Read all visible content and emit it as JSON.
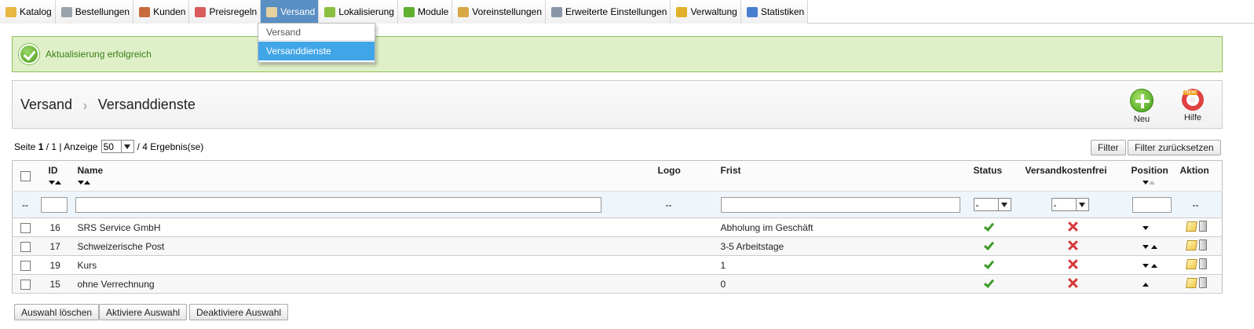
{
  "nav": {
    "items": [
      {
        "label": "Katalog",
        "icon": "folder-icon",
        "color": "#e8b642"
      },
      {
        "label": "Bestellungen",
        "icon": "cart-icon",
        "color": "#9aa3ab"
      },
      {
        "label": "Kunden",
        "icon": "user-icon",
        "color": "#c76b3c"
      },
      {
        "label": "Preisregeln",
        "icon": "price-rules-icon",
        "color": "#d95b5b"
      },
      {
        "label": "Versand",
        "icon": "truck-icon",
        "color": "#e7d1a1"
      },
      {
        "label": "Lokalisierung",
        "icon": "globe-icon",
        "color": "#8bbf3f"
      },
      {
        "label": "Module",
        "icon": "puzzle-icon",
        "color": "#5fb02f"
      },
      {
        "label": "Voreinstellungen",
        "icon": "preferences-icon",
        "color": "#d8a845"
      },
      {
        "label": "Erweiterte Einstellungen",
        "icon": "wrench-icon",
        "color": "#8a96a8"
      },
      {
        "label": "Verwaltung",
        "icon": "key-icon",
        "color": "#e2b12c"
      },
      {
        "label": "Statistiken",
        "icon": "bar-chart-icon",
        "color": "#4a7fd0"
      }
    ],
    "active": "Versand"
  },
  "dropdown": {
    "title": "Versand",
    "item": "Versanddienste"
  },
  "success": {
    "message": "Aktualisierung erfolgreich"
  },
  "toolbar": {
    "crumb1": "Versand",
    "separator": "›",
    "crumb2": "Versanddienste",
    "new_label": "Neu",
    "help_label": "Hilfe",
    "help_badge": "NEW"
  },
  "pager": {
    "seite_prefix": "Seite",
    "page": "1",
    "of": "/ 1 | Anzeige",
    "per_page": "50",
    "results": "/ 4 Ergebnis(se)"
  },
  "filter_buttons": {
    "filter": "Filter",
    "reset": "Filter zurücksetzen"
  },
  "columns": {
    "id": "ID",
    "name": "Name",
    "logo": "Logo",
    "frist": "Frist",
    "status": "Status",
    "versandkostenfrei": "Versandkostenfrei",
    "position": "Position",
    "aktion": "Aktion"
  },
  "filter_row": {
    "dash": "--",
    "logo_dash": "--",
    "aktion_dash": "--",
    "status_value": "-",
    "vkf_value": "-"
  },
  "rows": [
    {
      "id": "16",
      "name": "SRS Service GmbH",
      "frist": "Abholung im Geschäft",
      "status": true,
      "free": false,
      "pos": "down"
    },
    {
      "id": "17",
      "name": "Schweizerische Post",
      "frist": "3-5 Arbeitstage",
      "status": true,
      "free": false,
      "pos": "both"
    },
    {
      "id": "19",
      "name": "Kurs",
      "frist": "1",
      "status": true,
      "free": false,
      "pos": "both"
    },
    {
      "id": "15",
      "name": "ohne Verrechnung",
      "frist": "0",
      "status": true,
      "free": false,
      "pos": "up"
    }
  ],
  "bulk": {
    "delete": "Auswahl löschen",
    "activate": "Aktiviere Auswahl",
    "deactivate": "Deaktiviere Auswahl"
  }
}
